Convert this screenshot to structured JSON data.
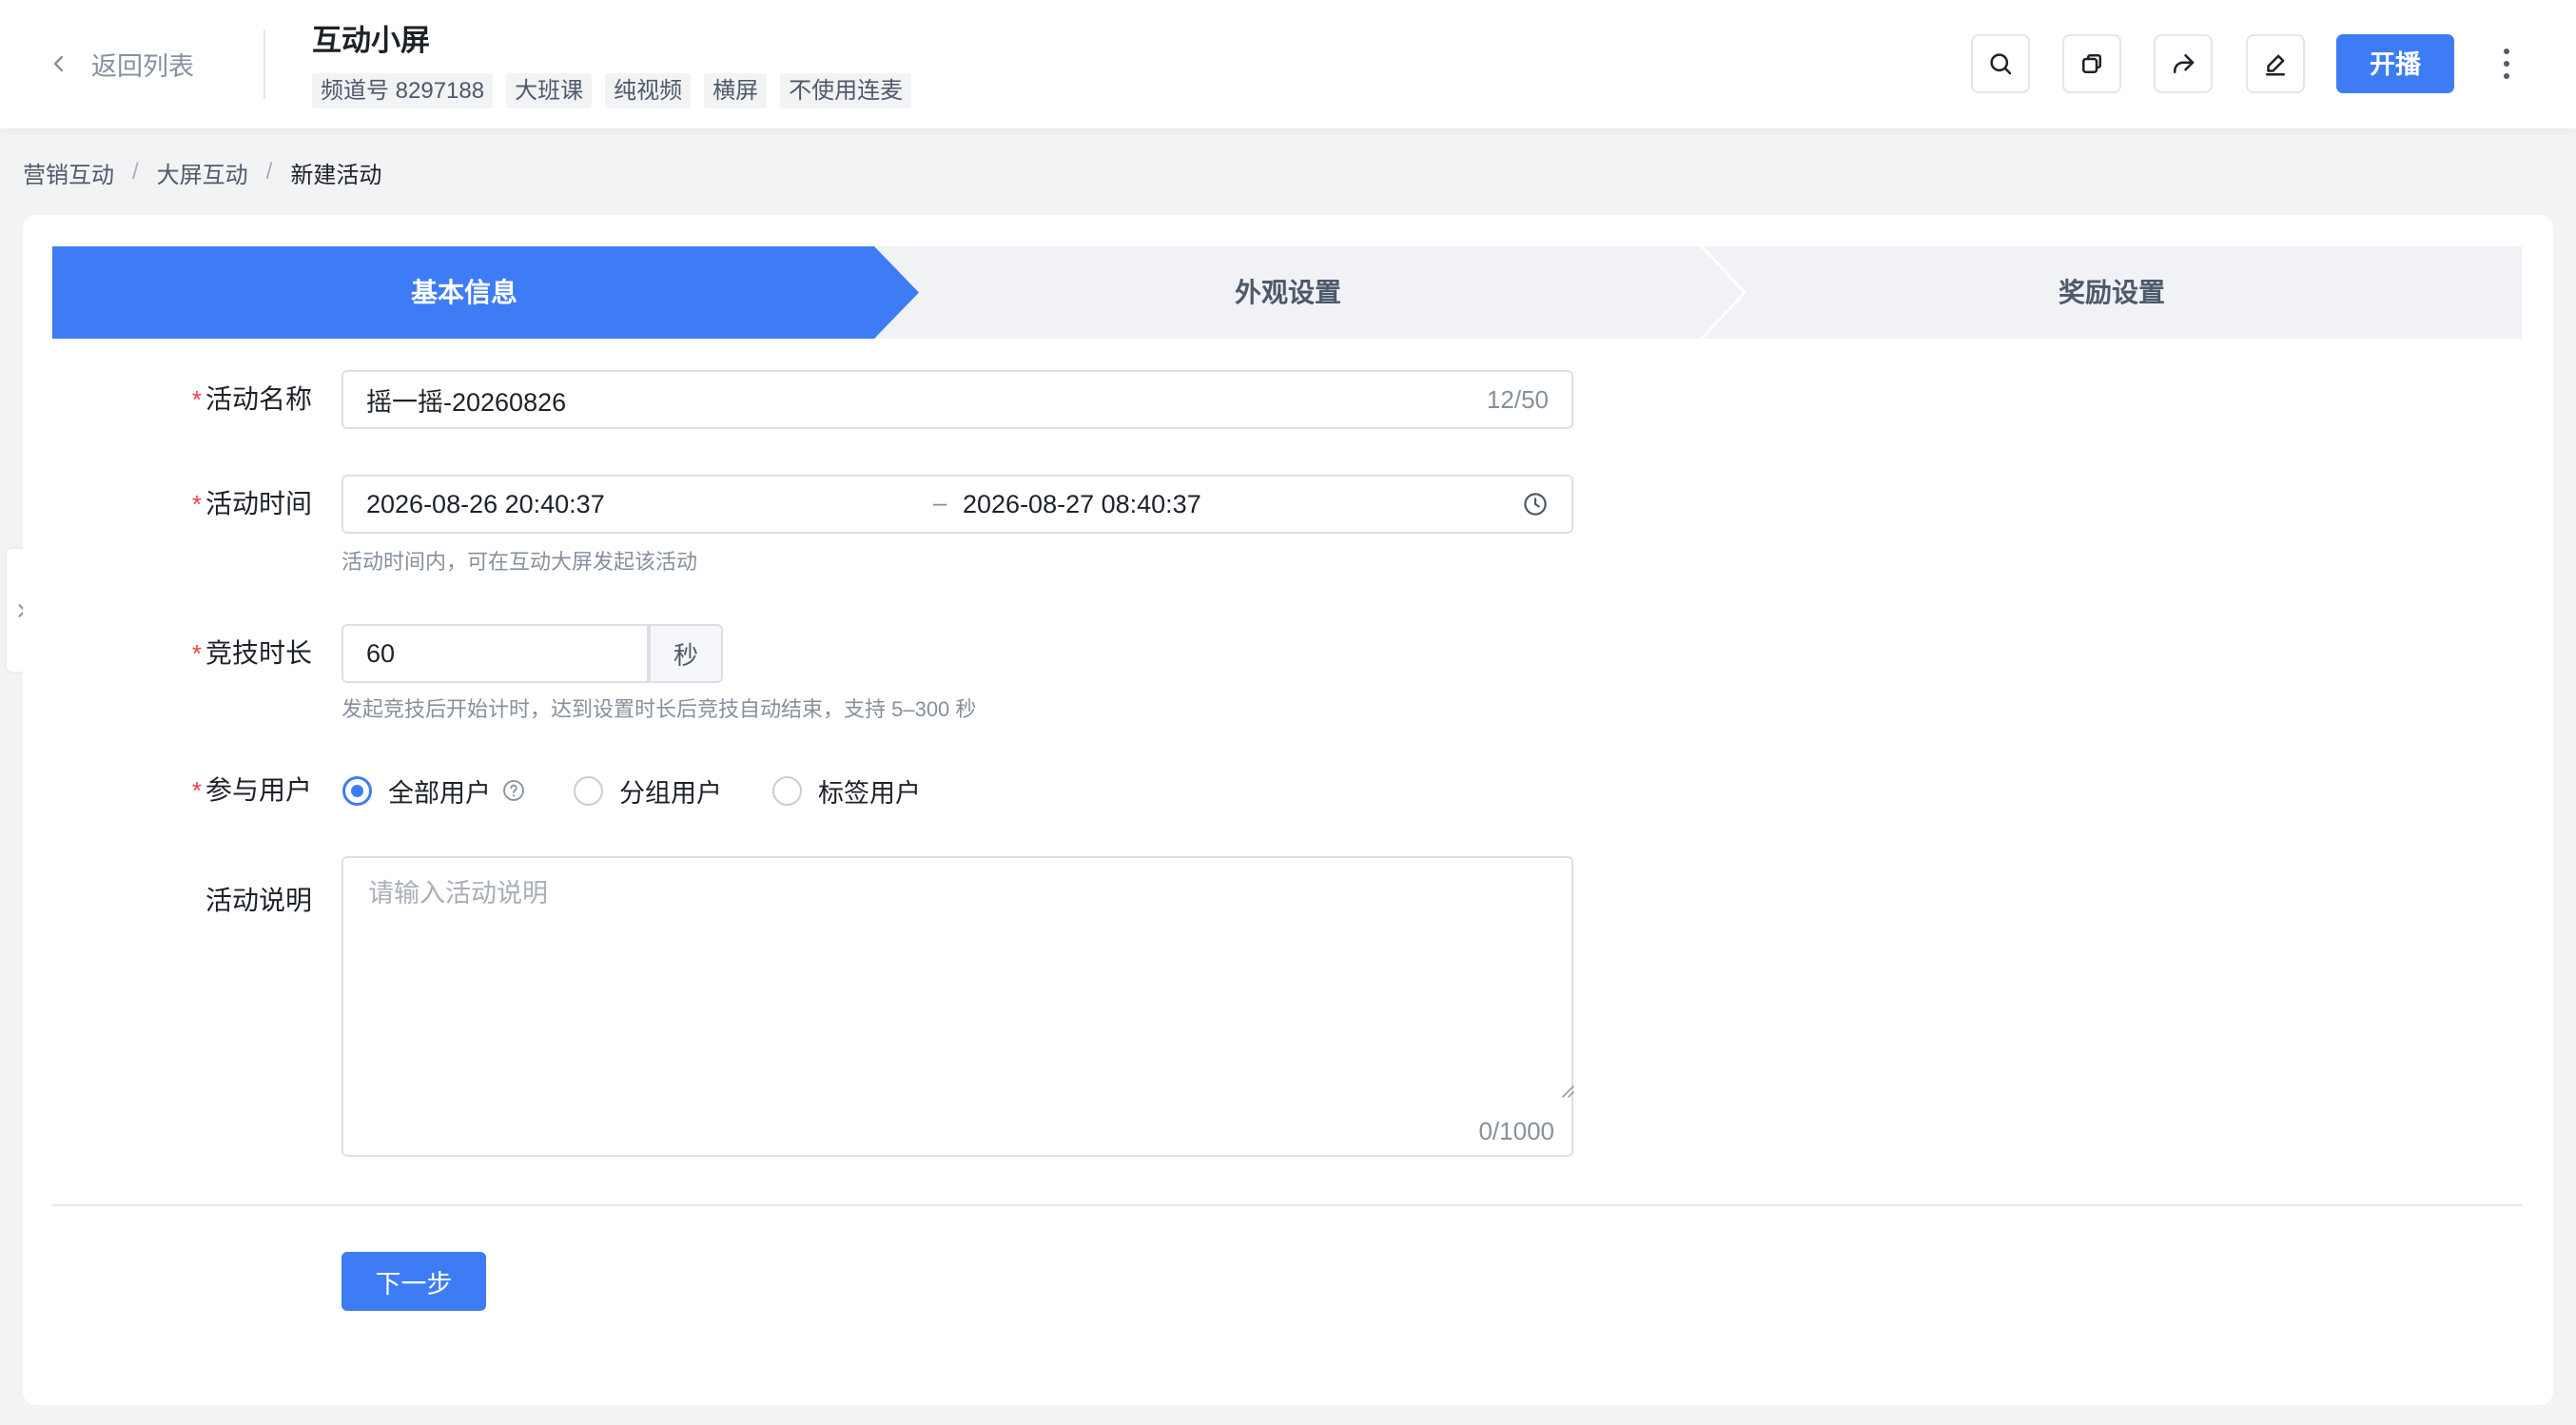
{
  "header": {
    "back_label": "返回列表",
    "title": "互动小屏",
    "tags": [
      "频道号 8297188",
      "大班课",
      "纯视频",
      "横屏",
      "不使用连麦"
    ],
    "action_icons": [
      "search-icon",
      "copy-icon",
      "share-icon",
      "edit-icon"
    ],
    "live_button": "开播",
    "more_icon": "more-vertical-icon"
  },
  "breadcrumb": {
    "items": [
      "营销互动",
      "大屏互动",
      "新建活动"
    ],
    "separator": "/"
  },
  "steps": [
    {
      "label": "基本信息",
      "active": true
    },
    {
      "label": "外观设置",
      "active": false
    },
    {
      "label": "奖励设置",
      "active": false
    }
  ],
  "form": {
    "required_mark": "*",
    "name": {
      "label": "活动名称",
      "value": "摇一摇-20260826",
      "counter": "12/50"
    },
    "time": {
      "label": "活动时间",
      "start": "2026-08-26 20:40:37",
      "separator": "–",
      "end": "2026-08-27 08:40:37",
      "icon": "clock-icon",
      "hint": "活动时间内，可在互动大屏发起该活动"
    },
    "duration": {
      "label": "竞技时长",
      "value": "60",
      "suffix": "秒",
      "hint": "发起竞技后开始计时，达到设置时长后竞技自动结束，支持 5–300 秒"
    },
    "users": {
      "label": "参与用户",
      "options": [
        {
          "label": "全部用户",
          "checked": true
        },
        {
          "label": "分组用户",
          "checked": false
        },
        {
          "label": "标签用户",
          "checked": false
        }
      ]
    },
    "description": {
      "label": "活动说明",
      "placeholder": "请输入活动说明",
      "value": "",
      "counter": "0/1000"
    }
  },
  "next_button": "下一步",
  "colors": {
    "primary": "#3e7cf6",
    "required": "#f53f3f",
    "page_background": "#f2f3f5",
    "hint": "#86909c"
  }
}
